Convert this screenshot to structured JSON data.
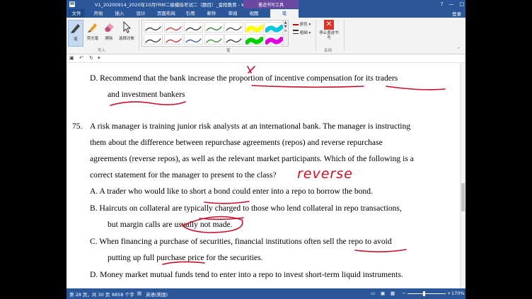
{
  "titlebar": {
    "title": "V1_20200914_2020年10月FRM二级模拟考试二（题目）_金程教育 - Word",
    "minimize": "?",
    "restore": "—",
    "close": "□"
  },
  "tabs": {
    "file": "文件",
    "items": [
      "开始",
      "插入",
      "设计",
      "页面布局",
      "引用",
      "邮件",
      "审阅",
      "视图",
      "笔"
    ],
    "tool_group": "墨迹书写工具",
    "login": "登录"
  },
  "ribbon": {
    "pen": "笔",
    "highlighter": "荧光笔",
    "eraser": "擦除",
    "select": "选择对象",
    "group_write": "写入",
    "group_pens": "笔",
    "color": "颜色",
    "thickness": "粗细",
    "stop": "停止墨迹书写",
    "group_close": "关闭",
    "pens": [
      {
        "color": "#333333"
      },
      {
        "color": "#d03030"
      },
      {
        "color": "#333333"
      },
      {
        "color": "#2a7a2a"
      },
      {
        "color": "#444444"
      },
      {
        "color": "#ffff00"
      },
      {
        "color": "#00c8e0"
      },
      {
        "color": "#333333"
      },
      {
        "color": "#c03030"
      },
      {
        "color": "#3050a0"
      },
      {
        "color": "#2a8a2a"
      },
      {
        "color": "#333333"
      },
      {
        "color": "#00d000"
      },
      {
        "color": "#e000e0"
      }
    ]
  },
  "qat": {
    "save": "💾",
    "undo": "↶",
    "redo": "↻"
  },
  "document": {
    "lines": [
      "D.    Recommend that the bank increase the proportion of incentive compensation for its traders",
      "and investment bankers",
      "75.",
      "A risk manager is training junior risk analysts at an international bank. The manager is instructing",
      "them about the difference between repurchase agreements (repos) and reverse repurchase",
      "agreements (reverse repos), as well as the relevant market participants. Which of the following is a",
      "correct statement for the manager to present to the class?",
      "A.    A trader who would like to short a bond could enter into a repo to borrow the bond.",
      "B.    Haircuts on collateral are typically charged to those who lend collateral in repo transactions,",
      "but margin calls are usually not made.",
      "C.    When financing a purchase of securities, financial institutions often sell the repo to avoid",
      "putting up full purchase price for the securities.",
      "D.    Money market mutual funds tend to enter into a repo to invest short-term liquid instruments."
    ],
    "handwritten_note": "reverse"
  },
  "status": {
    "page": "第 28 页，共 30 页",
    "words": "8858 个字",
    "lang": "英语(美国)",
    "zoom": "170%"
  }
}
